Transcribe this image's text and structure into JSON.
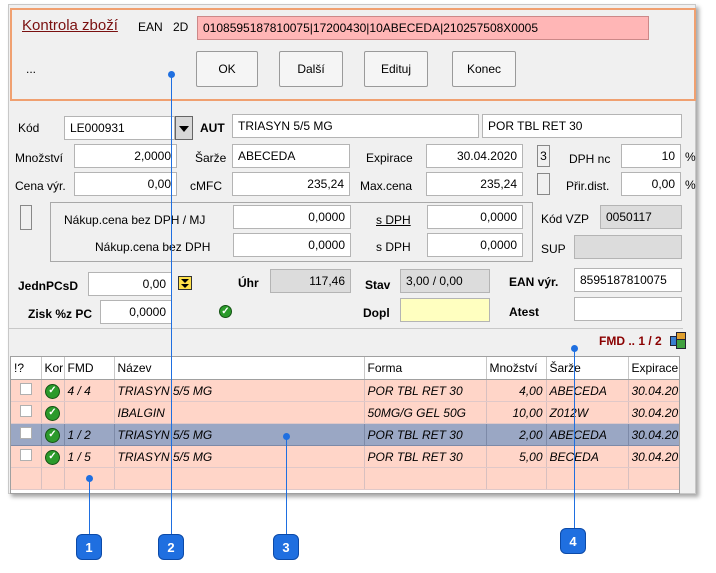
{
  "header": {
    "title": "Kontrola zboží",
    "ean_label": "EAN",
    "ean_2d_label": "2D",
    "ean_value": "0108595187810075|17200430|10ABECEDA|210257508X0005",
    "ellipsis": "...",
    "buttons": {
      "ok": "OK",
      "next": "Další",
      "edit": "Edituj",
      "end": "Konec"
    }
  },
  "form": {
    "kod_label": "Kód",
    "kod_value": "LE000931",
    "aut_label": "AUT",
    "name_value": "TRIASYN 5/5 MG",
    "form_value": "POR TBL RET 30",
    "mnozstvi_label": "Množství",
    "mnozstvi_value": "2,0000",
    "sarze_label": "Šarže",
    "sarze_value": "ABECEDA",
    "expirace_label": "Expirace",
    "expirace_value": "30.04.2020",
    "exp_box": "3",
    "dph_nc_label": "DPH nc",
    "dph_nc_value": "10",
    "pct1": "%",
    "cena_vyr_label": "Cena výr.",
    "cena_vyr_value": "0,00",
    "cmfc_label": "cMFC",
    "cmfc_value": "235,24",
    "max_cena_label": "Max.cena",
    "max_cena_value": "235,24",
    "prir_dist_label": "Přir.dist.",
    "prir_dist_value": "0,00",
    "pct2": "%",
    "nakup_mj_label": "Nákup.cena bez DPH / MJ",
    "nakup_mj_value": "0,0000",
    "s_dph_label1": "s DPH",
    "s_dph_value1": "0,0000",
    "nakup_label": "Nákup.cena bez DPH",
    "nakup_value": "0,0000",
    "s_dph_label2": "s DPH",
    "s_dph_value2": "0,0000",
    "kod_vzp_label": "Kód VZP",
    "kod_vzp_value": "0050117",
    "sup_label": "SUP",
    "sup_value": "",
    "jedn_label": "JednPCsD",
    "jedn_value": "0,00",
    "uhr_label": "Úhr",
    "uhr_value": "117,46",
    "stav_label": "Stav",
    "stav_value": "3,00 / 0,00",
    "ean_vyr_label": "EAN výr.",
    "ean_vyr_value": "8595187810075",
    "zisk_label": "Zisk %z PC",
    "zisk_value": "0,0000",
    "dopl_label": "Dopl",
    "dopl_value": "",
    "atest_label": "Atest",
    "atest_value": "",
    "fmd_status": "FMD .. 1 / 2"
  },
  "grid": {
    "headers": [
      "!?",
      "Kor",
      "FMD",
      "Název",
      "Forma",
      "Množství",
      "Šarže",
      "Expirace"
    ],
    "rows": [
      {
        "fmd": "4 / 4",
        "nazev": "TRIASYN 5/5 MG",
        "forma": "POR TBL RET 30",
        "mnozstvi": "4,00",
        "sarze": "ABECEDA",
        "expirace": "30.04.20"
      },
      {
        "fmd": "",
        "nazev": "IBALGIN",
        "forma": "50MG/G GEL 50G",
        "mnozstvi": "10,00",
        "sarze": "Z012W",
        "expirace": "30.04.20"
      },
      {
        "fmd": "1 / 2",
        "nazev": "TRIASYN 5/5 MG",
        "forma": "POR TBL RET 30",
        "mnozstvi": "2,00",
        "sarze": "ABECEDA",
        "expirace": "30.04.20"
      },
      {
        "fmd": "1 / 5",
        "nazev": "TRIASYN 5/5 MG",
        "forma": "POR TBL RET 30",
        "mnozstvi": "5,00",
        "sarze": "BECEDA",
        "expirace": "30.04.20"
      }
    ]
  },
  "callouts": {
    "c1": "1",
    "c2": "2",
    "c3": "3",
    "c4": "4"
  },
  "colors": {
    "accent": "#1f6fe0",
    "title": "#7a1010",
    "row": "#ffd5c8",
    "selected": "#9aa7c4",
    "ean_bg": "#ffb6b6"
  }
}
